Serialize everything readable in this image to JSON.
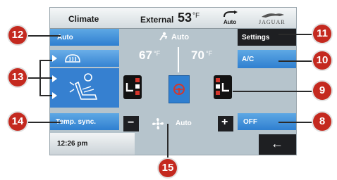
{
  "header": {
    "title": "Climate",
    "external_label": "External",
    "external_temp": "53",
    "temp_unit": "°F",
    "recirc_label": "Auto",
    "brand": "JAGUAR"
  },
  "left": {
    "auto_label": "Auto",
    "temp_sync_label": "Temp. sync."
  },
  "center": {
    "mode_label": "Auto",
    "left_temp": "67",
    "right_temp": "70",
    "unit": "°F",
    "fan_label": "Auto",
    "minus": "−",
    "plus": "+"
  },
  "right": {
    "settings_label": "Settings",
    "ac_label": "A/C",
    "off_label": "OFF"
  },
  "footer": {
    "time": "12:26 pm",
    "back_glyph": "←"
  },
  "callouts": [
    "12",
    "11",
    "13",
    "10",
    "9",
    "14",
    "8",
    "15"
  ],
  "colors": {
    "accent_blue": "#3a8ad8",
    "callout_red": "#c4291f",
    "heat_red": "#d4362c"
  },
  "icons": [
    "defrost-icon",
    "seat-airflow-icon",
    "seat-heater-icon",
    "steering-wheel-heater-icon",
    "fan-icon",
    "recirculation-icon",
    "back-arrow-icon"
  ]
}
